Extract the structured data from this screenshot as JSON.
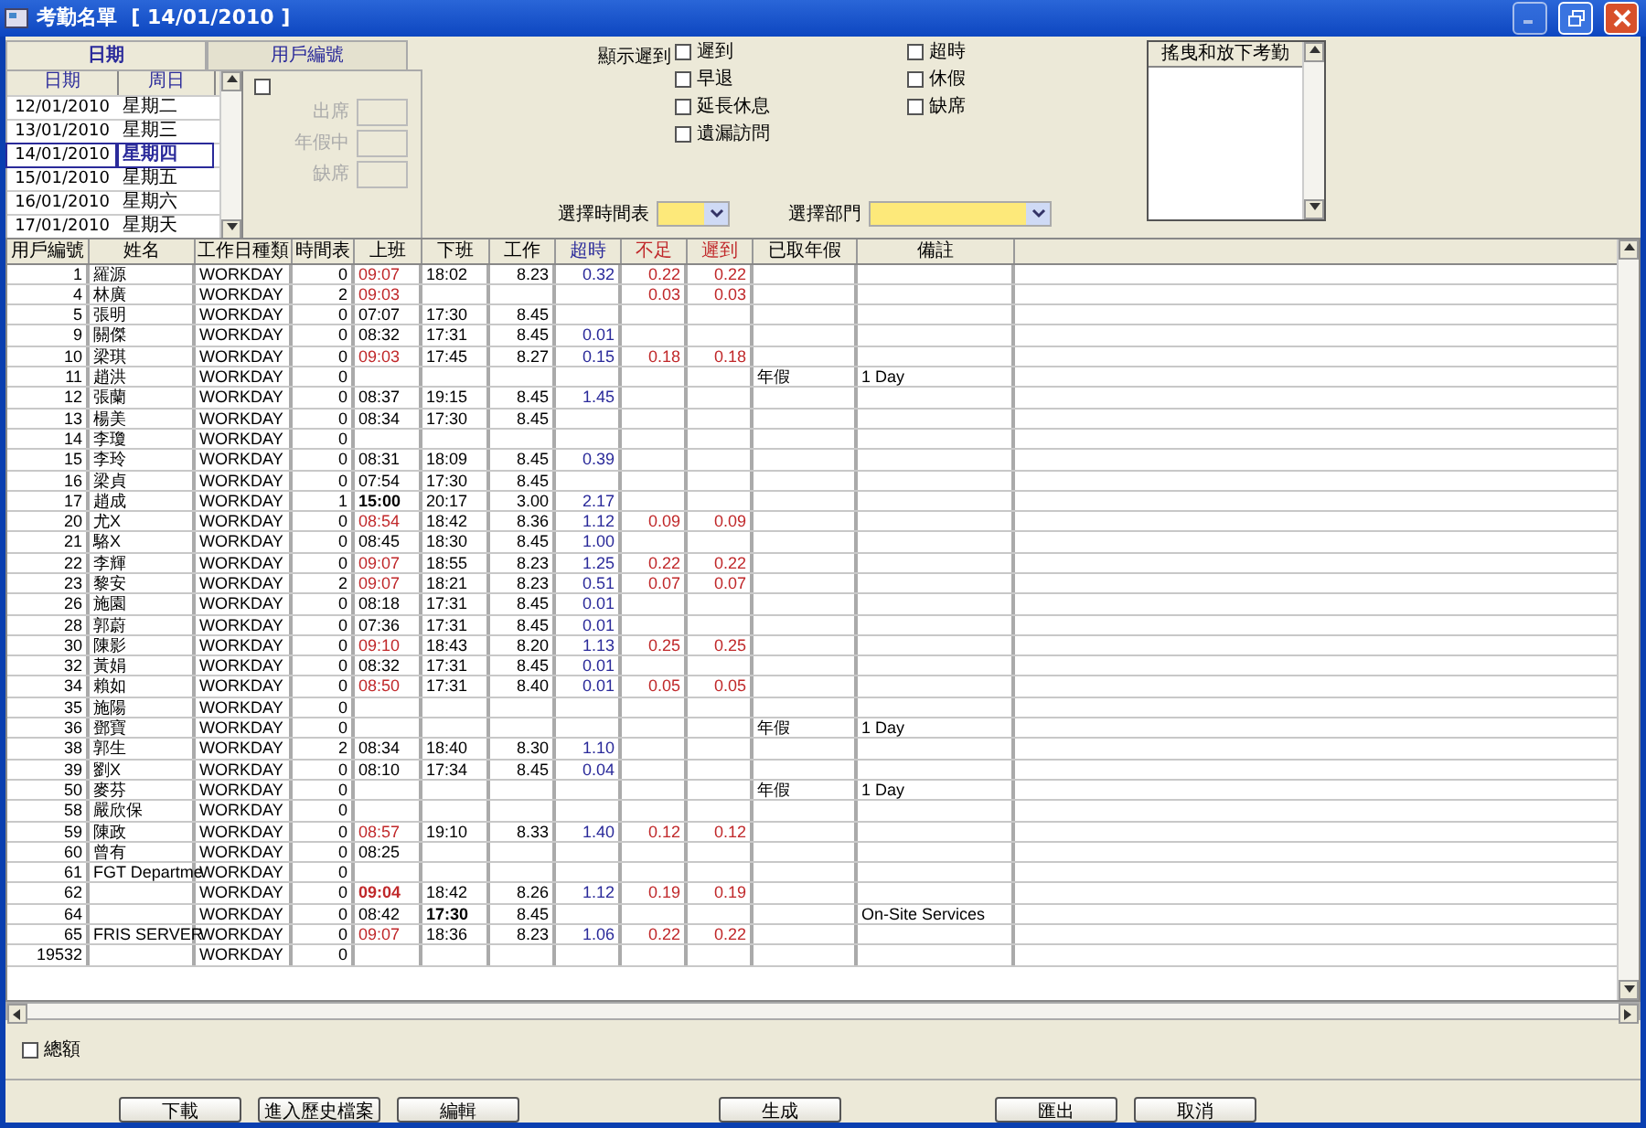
{
  "window": {
    "title": "考勤名單  [ 14/01/2010 ]"
  },
  "tabs": [
    {
      "label": "日期",
      "selected": true
    },
    {
      "label": "用戶編號",
      "selected": false
    }
  ],
  "date_list": {
    "columns": [
      "日期",
      "周日"
    ],
    "rows": [
      {
        "date": "12/01/2010",
        "weekday": "星期二",
        "selected": false
      },
      {
        "date": "13/01/2010",
        "weekday": "星期三",
        "selected": false
      },
      {
        "date": "14/01/2010",
        "weekday": "星期四",
        "selected": true
      },
      {
        "date": "15/01/2010",
        "weekday": "星期五",
        "selected": false
      },
      {
        "date": "16/01/2010",
        "weekday": "星期六",
        "selected": false
      },
      {
        "date": "17/01/2010",
        "weekday": "星期天",
        "selected": false
      }
    ]
  },
  "user_panel": {
    "checked": false,
    "fields": [
      {
        "label": "出席",
        "disabled": true
      },
      {
        "label": "年假中",
        "disabled": true
      },
      {
        "label": "缺席",
        "disabled": true
      }
    ]
  },
  "show_label": "顯示遲到",
  "filters": [
    {
      "label": "遲到",
      "checked": false
    },
    {
      "label": "早退",
      "checked": false
    },
    {
      "label": "延長休息",
      "checked": false
    },
    {
      "label": "遺漏訪問",
      "checked": false
    },
    {
      "label": "超時",
      "checked": false
    },
    {
      "label": "休假",
      "checked": false
    },
    {
      "label": "缺席",
      "checked": false
    }
  ],
  "selects": [
    {
      "label": "選擇時間表"
    },
    {
      "label": "選擇部門"
    }
  ],
  "drag_list": {
    "title": "搖曳和放下考勤"
  },
  "table": {
    "columns": [
      {
        "label": "用戶編號"
      },
      {
        "label": "姓名"
      },
      {
        "label": "工作日種類"
      },
      {
        "label": "時間表"
      },
      {
        "label": "上班"
      },
      {
        "label": "下班"
      },
      {
        "label": "工作"
      },
      {
        "label": "超時",
        "color": "#2a2a9a"
      },
      {
        "label": "不足",
        "color": "#c0282a"
      },
      {
        "label": "遲到",
        "color": "#c0282a"
      },
      {
        "label": "已取年假"
      },
      {
        "label": "備註"
      }
    ],
    "rows": [
      {
        "id": "1",
        "name": "羅源",
        "day_type": "WORKDAY",
        "schedule": "0",
        "time_in": "09:07",
        "time_out": "18:02",
        "work": "8.23",
        "overtime": "0.32",
        "short": "0.22",
        "late_by": "0.22",
        "late": true,
        "in_bold": false,
        "out_bold": false
      },
      {
        "id": "4",
        "name": "林廣",
        "day_type": "WORKDAY",
        "schedule": "2",
        "time_in": "09:03",
        "short": "0.03",
        "late_by": "0.03",
        "late": true,
        "in_bold": false
      },
      {
        "id": "5",
        "name": "張明",
        "day_type": "WORKDAY",
        "schedule": "0",
        "time_in": "07:07",
        "time_out": "17:30",
        "work": "8.45",
        "late": false,
        "in_bold": false,
        "out_bold": false
      },
      {
        "id": "9",
        "name": "關傑",
        "day_type": "WORKDAY",
        "schedule": "0",
        "time_in": "08:32",
        "time_out": "17:31",
        "work": "8.45",
        "overtime": "0.01",
        "late": false,
        "in_bold": false,
        "out_bold": false
      },
      {
        "id": "10",
        "name": "梁琪",
        "day_type": "WORKDAY",
        "schedule": "0",
        "time_in": "09:03",
        "time_out": "17:45",
        "work": "8.27",
        "overtime": "0.15",
        "short": "0.18",
        "late_by": "0.18",
        "late": true,
        "in_bold": false,
        "out_bold": false
      },
      {
        "id": "11",
        "name": "趙洪",
        "day_type": "WORKDAY",
        "schedule": "0",
        "leave": "年假",
        "remark": "1 Day"
      },
      {
        "id": "12",
        "name": "張蘭",
        "day_type": "WORKDAY",
        "schedule": "0",
        "time_in": "08:37",
        "time_out": "19:15",
        "work": "8.45",
        "overtime": "1.45",
        "late": false,
        "in_bold": false,
        "out_bold": false
      },
      {
        "id": "13",
        "name": "楊美",
        "day_type": "WORKDAY",
        "schedule": "0",
        "time_in": "08:34",
        "time_out": "17:30",
        "work": "8.45",
        "late": false,
        "in_bold": false,
        "out_bold": false
      },
      {
        "id": "14",
        "name": "李瓊",
        "day_type": "WORKDAY",
        "schedule": "0"
      },
      {
        "id": "15",
        "name": "李玲",
        "day_type": "WORKDAY",
        "schedule": "0",
        "time_in": "08:31",
        "time_out": "18:09",
        "work": "8.45",
        "overtime": "0.39",
        "late": false,
        "in_bold": false,
        "out_bold": false
      },
      {
        "id": "16",
        "name": "梁貞",
        "day_type": "WORKDAY",
        "schedule": "0",
        "time_in": "07:54",
        "time_out": "17:30",
        "work": "8.45",
        "late": false,
        "in_bold": false,
        "out_bold": false
      },
      {
        "id": "17",
        "name": "趙成",
        "day_type": "WORKDAY",
        "schedule": "1",
        "time_in": "15:00",
        "time_out": "20:17",
        "work": "3.00",
        "overtime": "2.17",
        "late": false,
        "in_bold": true,
        "out_bold": false
      },
      {
        "id": "20",
        "name": "尤X",
        "day_type": "WORKDAY",
        "schedule": "0",
        "time_in": "08:54",
        "time_out": "18:42",
        "work": "8.36",
        "overtime": "1.12",
        "short": "0.09",
        "late_by": "0.09",
        "late": true,
        "in_bold": false,
        "out_bold": false
      },
      {
        "id": "21",
        "name": "駱X",
        "day_type": "WORKDAY",
        "schedule": "0",
        "time_in": "08:45",
        "time_out": "18:30",
        "work": "8.45",
        "overtime": "1.00",
        "late": false,
        "in_bold": false,
        "out_bold": false
      },
      {
        "id": "22",
        "name": "李輝",
        "day_type": "WORKDAY",
        "schedule": "0",
        "time_in": "09:07",
        "time_out": "18:55",
        "work": "8.23",
        "overtime": "1.25",
        "short": "0.22",
        "late_by": "0.22",
        "late": true,
        "in_bold": false,
        "out_bold": false
      },
      {
        "id": "23",
        "name": "黎安",
        "day_type": "WORKDAY",
        "schedule": "2",
        "time_in": "09:07",
        "time_out": "18:21",
        "work": "8.23",
        "overtime": "0.51",
        "short": "0.07",
        "late_by": "0.07",
        "late": true,
        "in_bold": false,
        "out_bold": false
      },
      {
        "id": "26",
        "name": "施園",
        "day_type": "WORKDAY",
        "schedule": "0",
        "time_in": "08:18",
        "time_out": "17:31",
        "work": "8.45",
        "overtime": "0.01",
        "late": false,
        "in_bold": false,
        "out_bold": false
      },
      {
        "id": "28",
        "name": "郭蔚",
        "day_type": "WORKDAY",
        "schedule": "0",
        "time_in": "07:36",
        "time_out": "17:31",
        "work": "8.45",
        "overtime": "0.01",
        "late": false,
        "in_bold": false,
        "out_bold": false
      },
      {
        "id": "30",
        "name": "陳影",
        "day_type": "WORKDAY",
        "schedule": "0",
        "time_in": "09:10",
        "time_out": "18:43",
        "work": "8.20",
        "overtime": "1.13",
        "short": "0.25",
        "late_by": "0.25",
        "late": true,
        "in_bold": false,
        "out_bold": false
      },
      {
        "id": "32",
        "name": "黃娟",
        "day_type": "WORKDAY",
        "schedule": "0",
        "time_in": "08:32",
        "time_out": "17:31",
        "work": "8.45",
        "overtime": "0.01",
        "late": false,
        "in_bold": false,
        "out_bold": false
      },
      {
        "id": "34",
        "name": "賴如",
        "day_type": "WORKDAY",
        "schedule": "0",
        "time_in": "08:50",
        "time_out": "17:31",
        "work": "8.40",
        "overtime": "0.01",
        "short": "0.05",
        "late_by": "0.05",
        "late": true,
        "in_bold": false,
        "out_bold": false
      },
      {
        "id": "35",
        "name": "施陽",
        "day_type": "WORKDAY",
        "schedule": "0"
      },
      {
        "id": "36",
        "name": "鄧寶",
        "day_type": "WORKDAY",
        "schedule": "0",
        "leave": "年假",
        "remark": "1 Day"
      },
      {
        "id": "38",
        "name": "郭生",
        "day_type": "WORKDAY",
        "schedule": "2",
        "time_in": "08:34",
        "time_out": "18:40",
        "work": "8.30",
        "overtime": "1.10",
        "late": false,
        "in_bold": false,
        "out_bold": false
      },
      {
        "id": "39",
        "name": "劉X",
        "day_type": "WORKDAY",
        "schedule": "0",
        "time_in": "08:10",
        "time_out": "17:34",
        "work": "8.45",
        "overtime": "0.04",
        "late": false,
        "in_bold": false,
        "out_bold": false
      },
      {
        "id": "50",
        "name": "麥芬",
        "day_type": "WORKDAY",
        "schedule": "0",
        "leave": "年假",
        "remark": "1 Day"
      },
      {
        "id": "58",
        "name": "嚴欣保",
        "day_type": "WORKDAY",
        "schedule": "0"
      },
      {
        "id": "59",
        "name": "陳政",
        "day_type": "WORKDAY",
        "schedule": "0",
        "time_in": "08:57",
        "time_out": "19:10",
        "work": "8.33",
        "overtime": "1.40",
        "short": "0.12",
        "late_by": "0.12",
        "late": true,
        "in_bold": false,
        "out_bold": false
      },
      {
        "id": "60",
        "name": "曾有",
        "day_type": "WORKDAY",
        "schedule": "0",
        "time_in": "08:25",
        "late": false,
        "in_bold": false
      },
      {
        "id": "61",
        "name": "FGT Departme",
        "day_type": "WORKDAY",
        "schedule": "0"
      },
      {
        "id": "62",
        "day_type": "WORKDAY",
        "schedule": "0",
        "time_in": "09:04",
        "time_out": "18:42",
        "work": "8.26",
        "overtime": "1.12",
        "short": "0.19",
        "late_by": "0.19",
        "late": true,
        "in_bold": true,
        "out_bold": false
      },
      {
        "id": "64",
        "day_type": "WORKDAY",
        "schedule": "0",
        "time_in": "08:42",
        "time_out": "17:30",
        "work": "8.45",
        "remark": "On-Site Services",
        "late": false,
        "in_bold": false,
        "out_bold": true
      },
      {
        "id": "65",
        "name": "FRIS SERVER",
        "day_type": "WORKDAY",
        "schedule": "0",
        "time_in": "09:07",
        "time_out": "18:36",
        "work": "8.23",
        "overtime": "1.06",
        "short": "0.22",
        "late_by": "0.22",
        "late": true,
        "in_bold": false,
        "out_bold": false
      },
      {
        "id": "19532",
        "day_type": "WORKDAY",
        "schedule": "0"
      }
    ]
  },
  "total": {
    "label": "總額",
    "checked": false
  },
  "buttons": [
    "下載",
    "進入歷史檔案",
    "編輯",
    "生成",
    "匯出",
    "取消"
  ]
}
